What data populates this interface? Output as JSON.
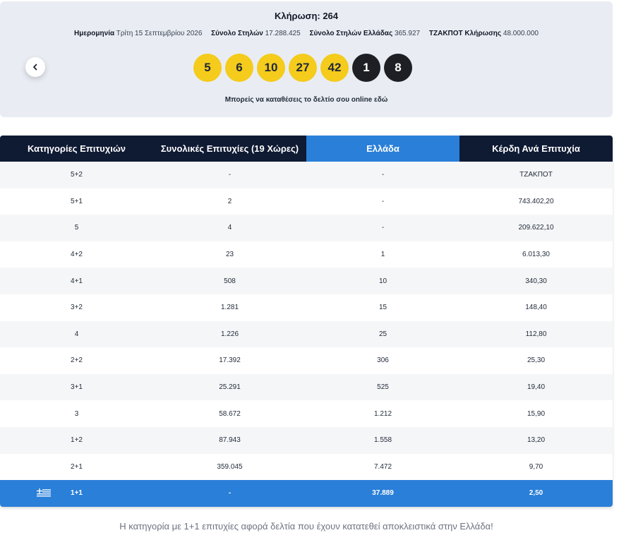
{
  "draw": {
    "title": "Κλήρωση: 264",
    "date_label": "Ημερομηνία",
    "date_value": "Τρίτη 15 Σεπτεμβρίου 2026",
    "total_columns_label": "Σύνολο Στηλών",
    "total_columns_value": "17.288.425",
    "greece_columns_label": "Σύνολο Στηλών Ελλάδας",
    "greece_columns_value": "365.927",
    "jackpot_label": "ΤΖΑΚΠΟΤ Κλήρωσης",
    "jackpot_value": "48.000.000",
    "main_numbers": [
      "5",
      "6",
      "10",
      "27",
      "42"
    ],
    "star_numbers": [
      "1",
      "8"
    ],
    "online_text": "Μπορείς να καταθέσεις το δελτίο σου online εδώ",
    "prev_icon": "chevron-left-icon"
  },
  "table": {
    "headers": [
      "Κατηγορίες Επιτυχιών",
      "Συνολικές Επιτυχίες (19 Χώρες)",
      "Ελλάδα",
      "Κέρδη Ανά Επιτυχία"
    ],
    "rows": [
      [
        "5+2",
        "-",
        "-",
        "ΤΖΑΚΠΟΤ"
      ],
      [
        "5+1",
        "2",
        "-",
        "743.402,20"
      ],
      [
        "5",
        "4",
        "-",
        "209.622,10"
      ],
      [
        "4+2",
        "23",
        "1",
        "6.013,30"
      ],
      [
        "4+1",
        "508",
        "10",
        "340,30"
      ],
      [
        "3+2",
        "1.281",
        "15",
        "148,40"
      ],
      [
        "4",
        "1.226",
        "25",
        "112,80"
      ],
      [
        "2+2",
        "17.392",
        "306",
        "25,30"
      ],
      [
        "3+1",
        "25.291",
        "525",
        "19,40"
      ],
      [
        "3",
        "58.672",
        "1.212",
        "15,90"
      ],
      [
        "1+2",
        "87.943",
        "1.558",
        "13,20"
      ],
      [
        "2+1",
        "359.045",
        "7.472",
        "9,70"
      ]
    ],
    "greek_row": [
      "1+1",
      "-",
      "37.889",
      "2,50"
    ],
    "greek_row_icon": "greek-flag-icon",
    "colors": {
      "header_dark": "#0f1a33",
      "header_greece": "#2a7fd8",
      "ball_main": "#f5cb1c",
      "ball_star": "#1e1f24"
    }
  },
  "footnote": "Η κατηγορία με 1+1 επιτυχίες αφορά δελτία που έχουν κατατεθεί αποκλειστικά στην Ελλάδα!"
}
